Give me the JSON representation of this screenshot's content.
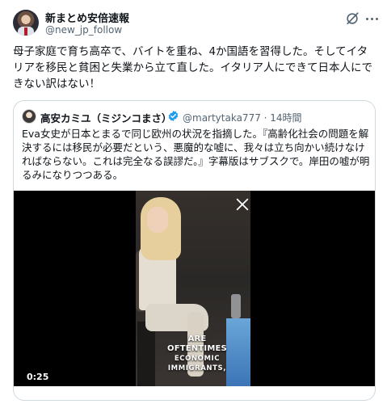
{
  "post": {
    "display_name": "新まとめ安倍速報",
    "handle": "@new_jp_follow",
    "text": "母子家庭で育ち高卒で、バイトを重ね、4か国語を習得した。そしてイタリアを移民と貧困と失業から立て直した。イタリア人にできて日本人にできない訳はない！",
    "icons": {
      "grok": "grok-icon",
      "more": "more-icon"
    }
  },
  "quote": {
    "display_name": "高安カミユ（ミジンコまさ）",
    "handle_time": "@martytaka777 · 14時間",
    "text": "Eva女史が日本とまるで同じ欧州の状況を指摘した。『高齢化社会の問題を解決するには移民が必要だという、悪魔的な嘘に、我々は立ち向かい続けなければならない。これは完全なる誤謬だ。』字幕版はサブスクで。岸田の嘘が明るみになりつつある。",
    "verified_color": "#1d9bf0"
  },
  "video": {
    "caption_line1": "ARE OFTENTIMES",
    "caption_line2": "ECONOMIC",
    "caption_line3": "IMMIGRANTS,",
    "duration": "0:25"
  }
}
